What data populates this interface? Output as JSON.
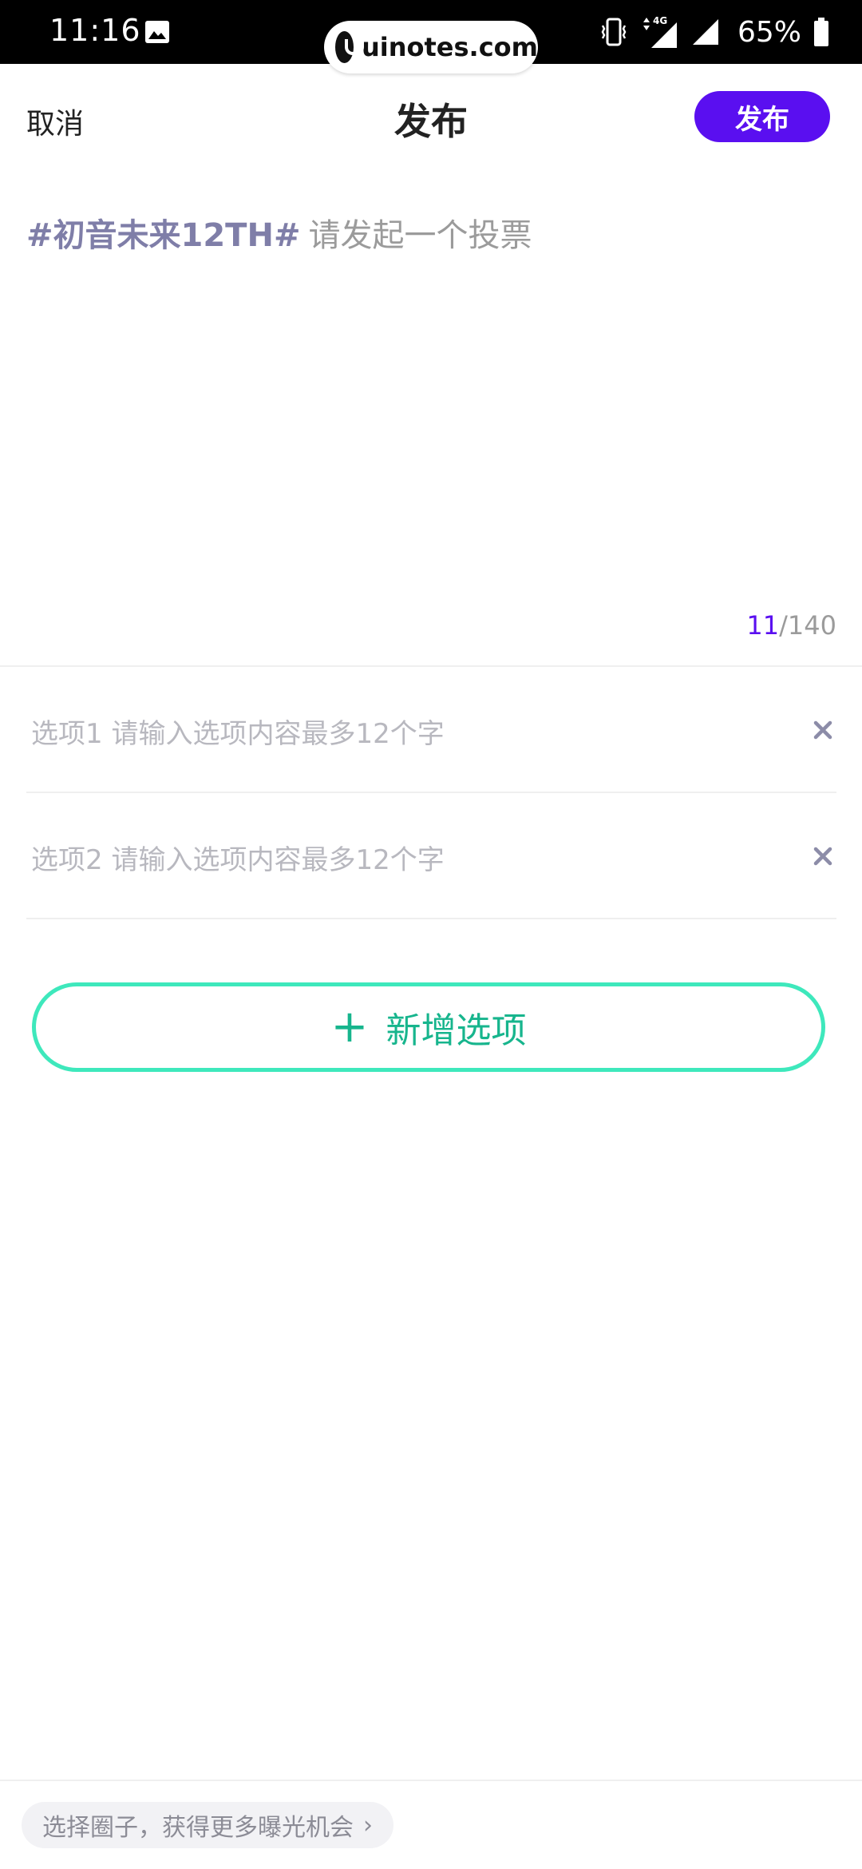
{
  "status_bar": {
    "time": "11:16",
    "battery": "65%",
    "network": "4G"
  },
  "watermark": {
    "text": "uinotes.com"
  },
  "header": {
    "cancel_label": "取消",
    "title": "发布",
    "publish_label": "发布"
  },
  "editor": {
    "hashtag": "#初音未来12TH#",
    "placeholder": "请发起一个投票",
    "count_current": "11",
    "count_max": "/140"
  },
  "options": [
    {
      "placeholder": "选项1 请输入选项内容最多12个字"
    },
    {
      "placeholder": "选项2 请输入选项内容最多12个字"
    }
  ],
  "add_option": {
    "plus": "+",
    "label": "新增选项"
  },
  "footer": {
    "circle_chip": "选择圈子，获得更多曝光机会",
    "chevron": "›"
  },
  "colors": {
    "accent": "#5a0ff0",
    "add_border": "#3ee8bc",
    "add_text": "#17b58d",
    "hashtag": "#7f7ea8"
  }
}
